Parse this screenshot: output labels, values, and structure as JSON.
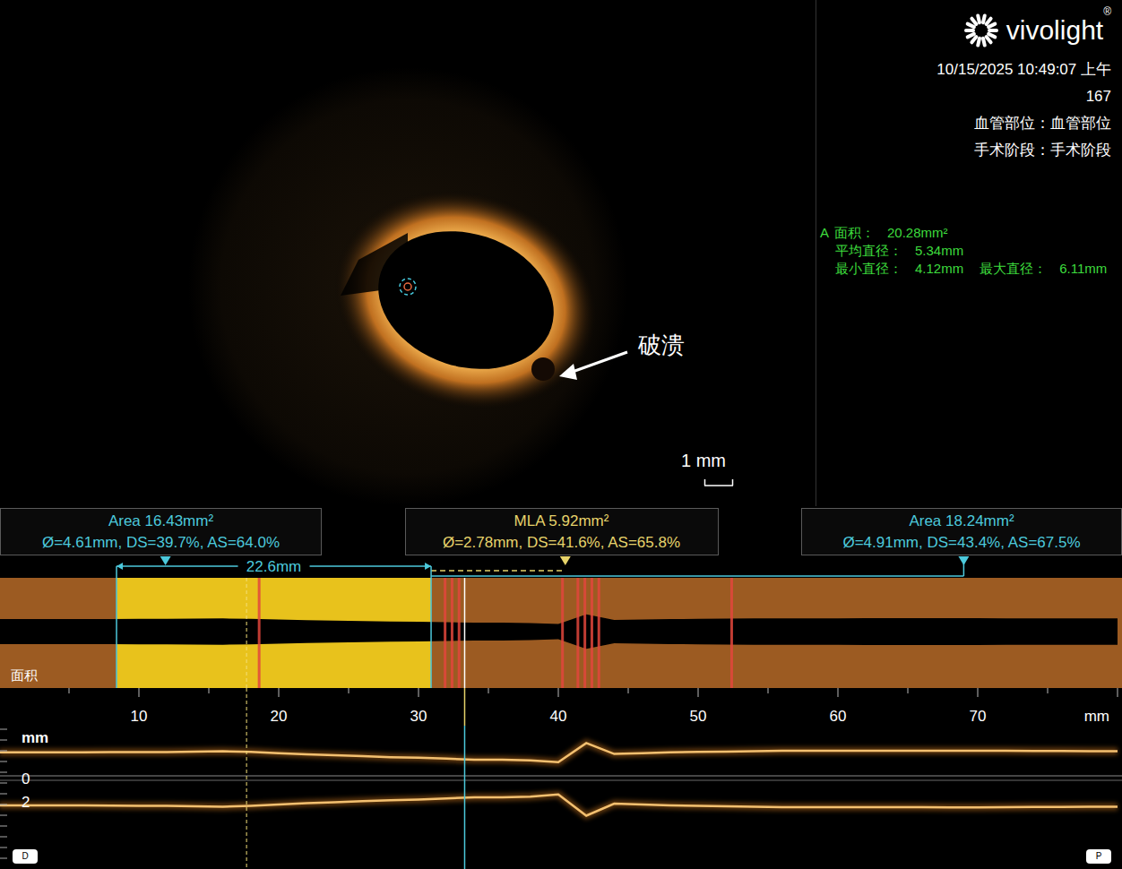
{
  "header": {
    "logo": "vivolight",
    "registered": "®",
    "datetime": "10/15/2025 10:49:07 上午",
    "frame": "167",
    "vessel": "血管部位：血管部位",
    "stage": "手术阶段：手术阶段"
  },
  "measurement": {
    "tag": "A",
    "area_label": "面积：",
    "area": "20.28mm²",
    "mean_label": "平均直径：",
    "mean": "5.34mm",
    "min_label": "最小直径：",
    "min": "4.12mm",
    "max_label": "最大直径：",
    "max": "6.11mm"
  },
  "cross_section": {
    "annotation": "破溃",
    "scale": "1 mm"
  },
  "summaries": [
    {
      "title": "Area 16.43mm²",
      "detail": "Ø=4.61mm, DS=39.7%, AS=64.0%",
      "color": "#4cc9dc",
      "marker_mm": 11.9
    },
    {
      "title": "MLA 5.92mm²",
      "detail": "Ø=2.78mm, DS=41.6%, AS=65.8%",
      "color": "#e6d36a",
      "marker_mm": 40.5
    },
    {
      "title": "Area 18.24mm²",
      "detail": "Ø=4.91mm, DS=43.4%, AS=67.5%",
      "color": "#4cc9dc",
      "marker_mm": 69.0
    }
  ],
  "segment": {
    "length": "22.6mm",
    "start_mm": 8.4,
    "end_mm": 30.9
  },
  "area_chart": {
    "label": "面积",
    "position_mm": [
      0,
      2,
      4,
      6,
      8,
      10,
      12,
      14,
      16,
      18,
      20,
      22,
      24,
      26,
      28,
      30,
      32,
      34,
      36,
      38,
      40,
      42,
      44,
      46,
      48,
      50,
      52,
      54,
      56,
      58,
      60,
      62,
      64,
      66,
      68,
      70,
      72,
      74,
      76,
      78,
      80
    ],
    "area_mm2": [
      16,
      16,
      16,
      16,
      16.2,
      16.4,
      16.4,
      17,
      17.5,
      16.5,
      15,
      13.5,
      12.5,
      11.5,
      10.5,
      10,
      9,
      8,
      8,
      7.5,
      5.92,
      30,
      14,
      15,
      16,
      16.5,
      17,
      17.5,
      18,
      18,
      18,
      18.2,
      18.2,
      18.2,
      18.24,
      18.24,
      18,
      17.8,
      17.8,
      17.6,
      17.6
    ],
    "frame_marks_mm": [
      18.6,
      31.9,
      32.4,
      32.9,
      40.3,
      41.4,
      41.9,
      42.4,
      42.9,
      52.4
    ],
    "current_mm": 33.3,
    "dashed_mm": 17.7
  },
  "ruler": {
    "ticks": [
      "10",
      "20",
      "30",
      "40",
      "50",
      "60",
      "70"
    ],
    "unit": "mm"
  },
  "longitudinal": {
    "unit": "mm",
    "depth_ticks": [
      "0",
      "2"
    ],
    "distal": "D",
    "proximal": "P"
  }
}
